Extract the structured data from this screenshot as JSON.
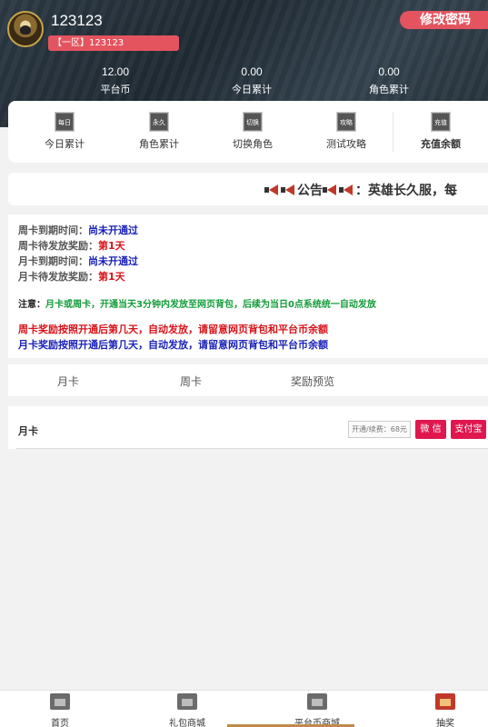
{
  "header": {
    "username": "123123",
    "server": "【一区】123123",
    "change_password": "修改密码",
    "stats": [
      {
        "value": "12.00",
        "label": "平台币"
      },
      {
        "value": "0.00",
        "label": "今日累计"
      },
      {
        "value": "0.00",
        "label": "角色累计"
      }
    ]
  },
  "menu": {
    "items": [
      {
        "icon": "每日",
        "label": "今日累计"
      },
      {
        "icon": "永久",
        "label": "角色累计"
      },
      {
        "icon": "切换",
        "label": "切换角色"
      },
      {
        "icon": "攻略",
        "label": "测试攻略"
      },
      {
        "icon": "充值",
        "label": "充值余额"
      }
    ]
  },
  "notice": {
    "text": "公告",
    "marquee": "：英雄长久服，每"
  },
  "info": {
    "week_expire_label": "周卡到期时间：",
    "week_expire_value": "尚未开通过",
    "week_reward_label": "周卡待发放奖励：",
    "week_reward_value": "第1天",
    "month_expire_label": "月卡到期时间：",
    "month_expire_value": "尚未开通过",
    "month_reward_label": "月卡待发放奖励：",
    "month_reward_value": "第1天",
    "note_label": "注意：",
    "note_text": "月卡或周卡，开通当天3分钟内发放至网页背包，后续为当日0点系统统一自动发放",
    "week_rule": "周卡奖励按照开通后第几天，自动发放，请留意网页背包和平台币余额",
    "month_rule": "月卡奖励按照开通后第几天，自动发放，请留意网页背包和平台币余额"
  },
  "tabs": [
    "月卡",
    "周卡",
    "奖励预览"
  ],
  "card": {
    "title": "月卡",
    "price": "开通/续费：68元",
    "wechat": "微 信",
    "alipay": "支付宝"
  },
  "bottom_nav": [
    {
      "label": "首页",
      "icon": "home-icon"
    },
    {
      "label": "礼包商城",
      "icon": "gift-shop-icon"
    },
    {
      "label": "平台币商城",
      "icon": "coin-shop-icon"
    },
    {
      "label": "抽奖",
      "icon": "lottery-icon"
    }
  ],
  "colors": {
    "accent_red": "#e4545f",
    "pay_button": "#e0174f",
    "link_blue": "#1a22b8",
    "warn_red": "#d8131a",
    "note_green": "#139c3a"
  }
}
